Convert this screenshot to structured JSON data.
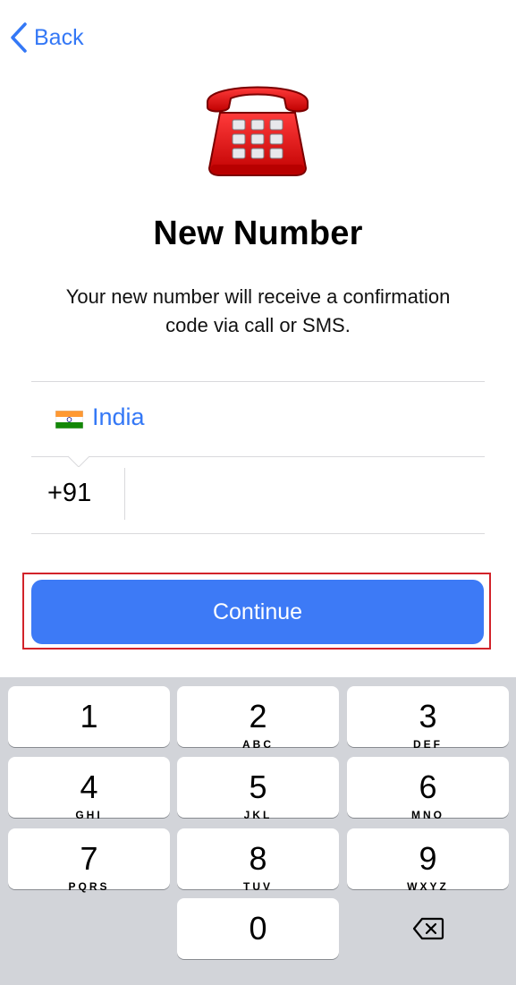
{
  "nav": {
    "back_label": "Back"
  },
  "header": {
    "icon": "red-telephone-icon",
    "title": "New Number",
    "subtitle": "Your new number will receive a confirmation code via call or SMS."
  },
  "country": {
    "flag": "india-flag-icon",
    "name": "India"
  },
  "phone": {
    "code": "+91",
    "value": ""
  },
  "continue_label": "Continue",
  "keypad": {
    "keys": [
      {
        "num": "1",
        "letters": ""
      },
      {
        "num": "2",
        "letters": "ABC"
      },
      {
        "num": "3",
        "letters": "DEF"
      },
      {
        "num": "4",
        "letters": "GHI"
      },
      {
        "num": "5",
        "letters": "JKL"
      },
      {
        "num": "6",
        "letters": "MNO"
      },
      {
        "num": "7",
        "letters": "PQRS"
      },
      {
        "num": "8",
        "letters": "TUV"
      },
      {
        "num": "9",
        "letters": "WXYZ"
      },
      {
        "num": "0",
        "letters": ""
      }
    ],
    "delete_icon": "backspace-icon"
  },
  "colors": {
    "accent": "#3478f6",
    "button": "#3d7af6",
    "highlight_frame": "#d2232a",
    "keyboard_bg": "#d2d4d9"
  }
}
